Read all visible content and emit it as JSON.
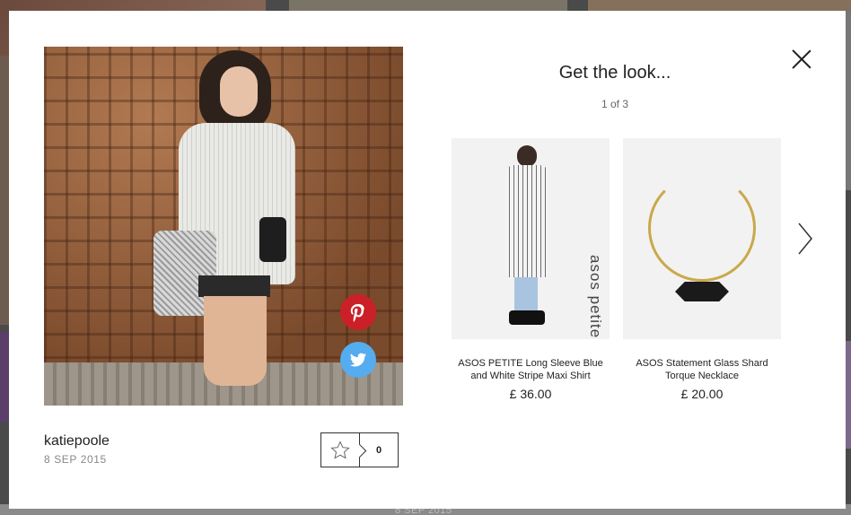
{
  "background": {
    "date_text": "8 SEP 2015"
  },
  "post": {
    "username": "katiepoole",
    "date": "8 SEP 2015",
    "like_count": "0"
  },
  "share": {
    "pinterest_icon": "pinterest-icon",
    "twitter_icon": "twitter-icon"
  },
  "get_the_look": {
    "title": "Get the look...",
    "counter": "1 of 3",
    "products": [
      {
        "name": "ASOS PETITE Long Sleeve Blue and White Stripe Maxi Shirt",
        "price": "£ 36.00",
        "image_brand_text": "asos petite"
      },
      {
        "name": "ASOS Statement Glass Shard Torque Necklace",
        "price": "£ 20.00"
      }
    ]
  },
  "colors": {
    "pinterest": "#cb2027",
    "twitter": "#55acee",
    "text": "#222222"
  }
}
